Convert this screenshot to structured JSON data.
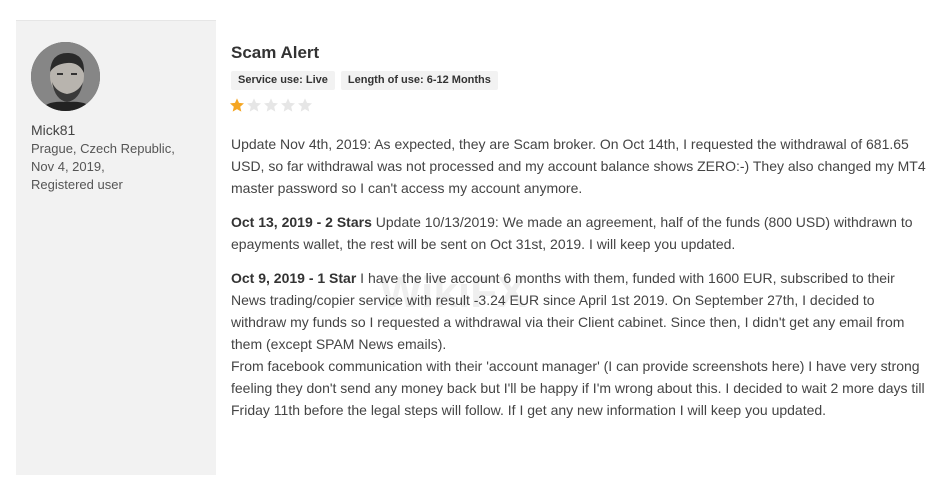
{
  "reviewer": {
    "name": "Mick81",
    "location": "Prague, Czech Republic,",
    "date": "Nov 4, 2019,",
    "status": "Registered user"
  },
  "review": {
    "title": "Scam Alert",
    "tags": [
      {
        "label": "Service use: Live"
      },
      {
        "label": "Length of use: 6-12 Months"
      }
    ],
    "rating": 1,
    "rating_max": 5,
    "paragraph1": "Update Nov 4th, 2019: As expected, they are Scam broker. On Oct 14th, I requested the withdrawal of 681.65 USD, so far withdrawal was not processed and my account balance shows ZERO:-) They also changed my MT4 master password so I can't access my account anymore.",
    "paragraph2_heading": "Oct 13, 2019 - 2 Stars",
    "paragraph2_text": " Update 10/13/2019: We made an agreement, half of the funds (800 USD) withdrawn to epayments wallet, the rest will be sent on Oct 31st, 2019. I will keep you updated.",
    "paragraph3_heading": "Oct 9, 2019 - 1 Star",
    "paragraph3_text": " I have the live account 6 months with them, funded with 1600 EUR, subscribed to their News trading/copier service with result -3.24 EUR since April 1st 2019. On September 27th, I decided to withdraw my funds so I requested a withdrawal via their Client cabinet. Since then, I didn't get any email from them (except SPAM News emails).",
    "paragraph4": "From facebook communication with their 'account manager' (I can provide screenshots here) I have very strong feeling they don't send any money back but I'll be happy if I'm wrong about this. I decided to wait 2 more days till Friday 11th before the legal steps will follow. If I get any new information I will keep you updated."
  },
  "watermark": {
    "text": "WikiFX"
  },
  "colors": {
    "star_filled": "#f5a623",
    "star_empty": "#e6e6e6",
    "sidebar_bg": "#f2f2f2",
    "tag_bg": "#f2f2f2"
  }
}
